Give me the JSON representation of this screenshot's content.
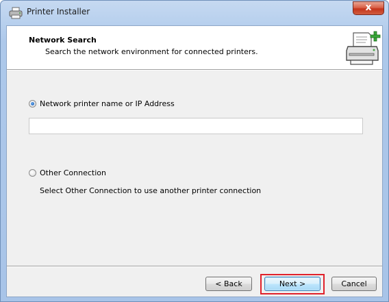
{
  "window": {
    "title": "Printer Installer",
    "close_label": "x"
  },
  "header": {
    "title": "Network Search",
    "subtitle": "Search the network environment for connected printers."
  },
  "options": {
    "network_label": "Network printer name or IP Address",
    "network_selected": true,
    "network_input_value": "",
    "other_label": "Other Connection",
    "other_selected": false,
    "other_description": "Select Other Connection to use another printer connection"
  },
  "buttons": {
    "back_label": "< Back",
    "next_label": "Next >",
    "cancel_label": "Cancel"
  },
  "colors": {
    "highlight": "#e0202a",
    "accent": "#3c7fb1"
  }
}
